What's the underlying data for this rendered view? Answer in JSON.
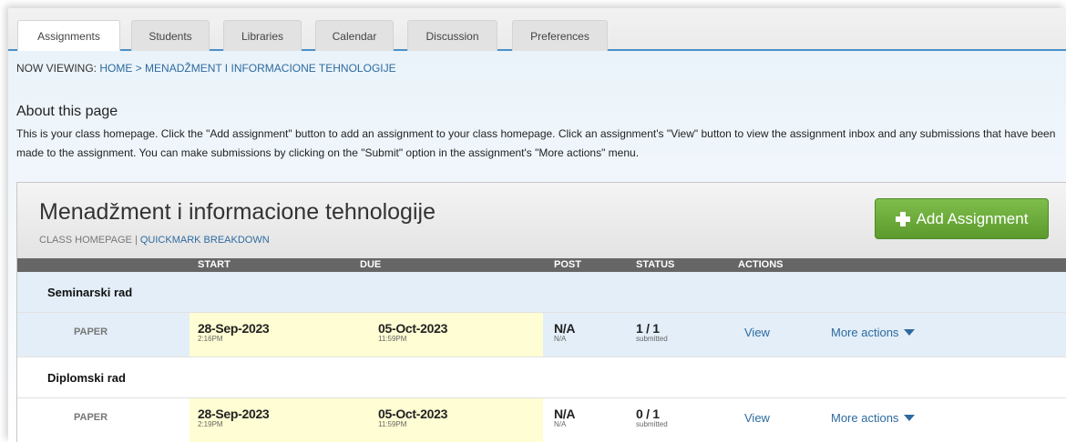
{
  "tabs": [
    "Assignments",
    "Students",
    "Libraries",
    "Calendar",
    "Discussion",
    "Preferences"
  ],
  "breadcrumb": {
    "prefix": "NOW VIEWING: ",
    "home": "HOME",
    "sep": " > ",
    "current": "MENADŽMENT I INFORMACIONE TEHNOLOGIJE"
  },
  "about": {
    "title": "About this page",
    "text": "This is your class homepage. Click the \"Add assignment\" button to add an assignment to your class homepage. Click an assignment's \"View\" button to view the assignment inbox and any submissions that have been made to the assignment. You can make submissions by clicking on the \"Submit\" option in the assignment's \"More actions\" menu."
  },
  "class": {
    "title": "Menadžment i informacione tehnologije",
    "link_homepage": "CLASS HOMEPAGE",
    "link_sep": " | ",
    "link_quickmark": "QUICKMARK BREAKDOWN",
    "add_button": "Add Assignment"
  },
  "columns": {
    "start": "START",
    "due": "DUE",
    "post": "POST",
    "status": "STATUS",
    "actions": "ACTIONS"
  },
  "assignments": [
    {
      "name": "Seminarski rad",
      "type": "PAPER",
      "start_date": "28-Sep-2023",
      "start_time": "2:16PM",
      "due_date": "05-Oct-2023",
      "due_time": "11:59PM",
      "post": "N/A",
      "post_sub": "N/A",
      "status": "1 / 1",
      "status_sub": "submitted",
      "view": "View",
      "more": "More actions"
    },
    {
      "name": "Diplomski rad",
      "type": "PAPER",
      "start_date": "28-Sep-2023",
      "start_time": "2:19PM",
      "due_date": "05-Oct-2023",
      "due_time": "11:59PM",
      "post": "N/A",
      "post_sub": "N/A",
      "status": "0 / 1",
      "status_sub": "submitted",
      "view": "View",
      "more": "More actions"
    }
  ],
  "colors": {
    "link": "#2d6a9f",
    "add_button": "#6aab3a",
    "header_bar": "#666666",
    "date_highlight": "#fffdd3",
    "selected_group": "#e3eef8"
  }
}
